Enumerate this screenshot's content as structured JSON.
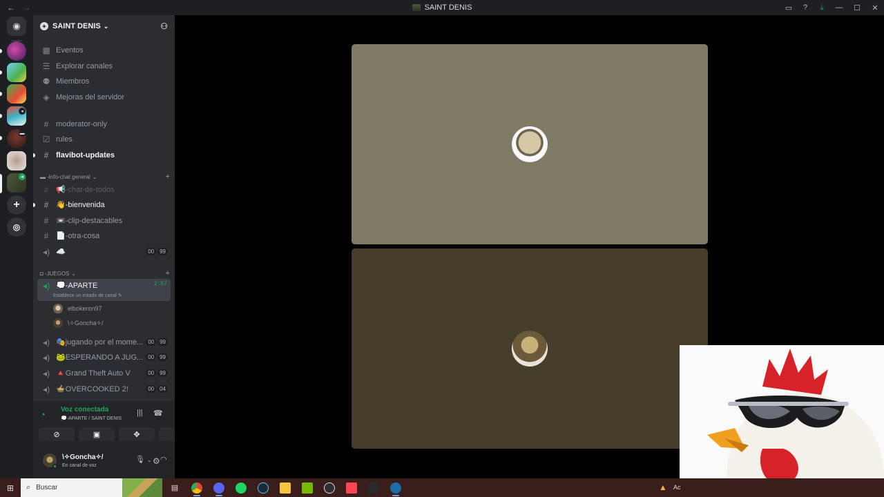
{
  "window": {
    "title": "SAINT DENIS",
    "nav_back": "←",
    "nav_forward": "→"
  },
  "titlebar_icons": [
    "inbox-icon",
    "help-icon",
    "download-icon",
    "minimize-icon",
    "maximize-icon",
    "close-icon"
  ],
  "server": {
    "name": "SAINT DENIS",
    "chevron": "⌄"
  },
  "server_menu": [
    {
      "label": "Eventos",
      "icon": "calendar-icon"
    },
    {
      "label": "Explorar canales",
      "icon": "browse-channels-icon"
    },
    {
      "label": "Miembros",
      "icon": "members-icon"
    },
    {
      "label": "Mejoras del servidor",
      "icon": "boost-icon"
    }
  ],
  "channels_top": [
    {
      "label": "moderator-only",
      "icon": "hash-icon",
      "unread": false
    },
    {
      "label": "rules",
      "icon": "rules-icon",
      "unread": false
    },
    {
      "label": "flavibot-updates",
      "icon": "hash-icon",
      "unread": true
    }
  ],
  "category_info": {
    "label": "-Info-chat general",
    "chevron": "⌄",
    "plus": "+"
  },
  "info_channels": [
    {
      "label": "📢-chat-de-todos",
      "state": "muted"
    },
    {
      "label": "👋-bienvenida",
      "state": "unread"
    },
    {
      "label": "📼-clip-destacables",
      "state": "normal"
    },
    {
      "label": "📄-otra-cosa",
      "state": "normal"
    }
  ],
  "voice_cloud": {
    "label": "☁️",
    "counts": [
      "00",
      "99"
    ]
  },
  "category_games": {
    "label": "-JUEGOS",
    "chevron": "⌄",
    "plus": "+"
  },
  "active_voice": {
    "label": "💭-APARTE",
    "timer": "2:57",
    "status_hint": "Establece un estado de canal ✎",
    "users": [
      "elbokeron97",
      "\\✧Goncha✧/"
    ]
  },
  "voice_channels": [
    {
      "label": "🎭jugando por el mome...",
      "counts": [
        "00",
        "99"
      ]
    },
    {
      "label": "🐸ESPERANDO A JUG...",
      "counts": [
        "00",
        "99"
      ]
    },
    {
      "label": "🔺Grand Theft Auto V",
      "counts": [
        "00",
        "99"
      ]
    },
    {
      "label": "🍲OVERCOOKED 2!",
      "counts": [
        "00",
        "04"
      ]
    }
  ],
  "voice_panel": {
    "title": "Voz conectada",
    "subtitle": "💭-APARTE / SAINT DENIS",
    "buttons": [
      "camera-off-icon",
      "screen-share-icon",
      "activities-icon",
      "soundboard-icon"
    ]
  },
  "user": {
    "name": "\\✧Goncha✧/",
    "status": "En canal de voz"
  },
  "taskbar": {
    "search_placeholder": "Buscar",
    "apps": [
      "task-view-icon",
      "chrome-icon",
      "discord-icon",
      "spotify-icon",
      "steam-icon",
      "explorer-icon",
      "nvidia-icon",
      "obs-icon",
      "valorant-icon",
      "epic-icon",
      "steam-alt-icon"
    ],
    "tray_text": "Ac"
  },
  "colors": {
    "accent_green": "#23a55a",
    "sidebar_bg": "#2b2d31",
    "rail_bg": "#1e1f22",
    "tile_top": "#7f7a66",
    "tile_bottom": "#463d2a",
    "taskbar_bg": "#3a1e1c"
  }
}
